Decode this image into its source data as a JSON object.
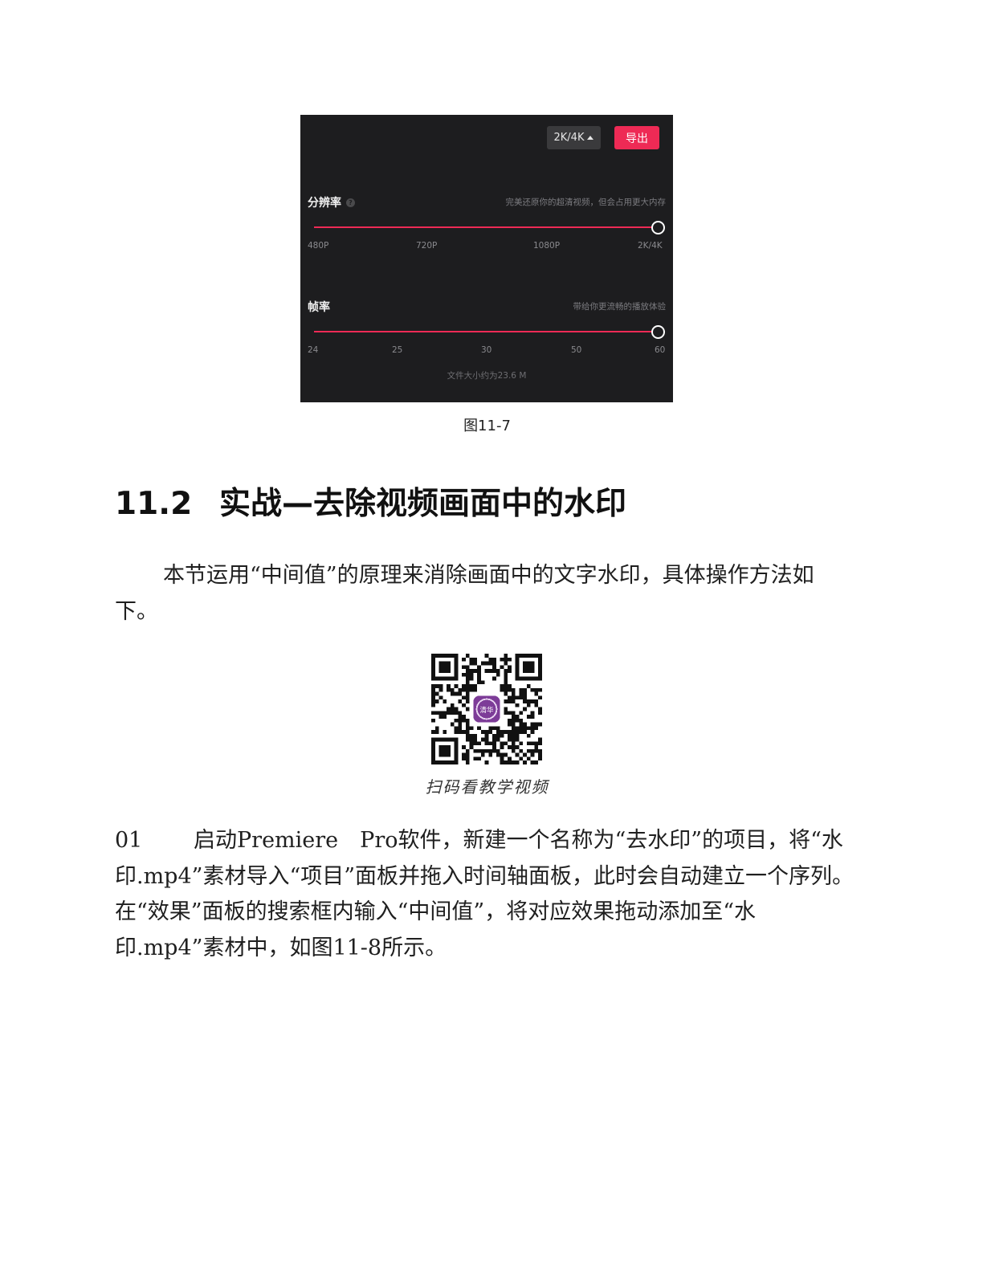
{
  "figure": {
    "resolution_button": "2K/4K",
    "export_button": "导出",
    "resolution": {
      "title": "分辨率",
      "help_mark": "?",
      "description": "完美还原你的超清视频，但会占用更大内存",
      "ticks": [
        "480P",
        "720P",
        "1080P",
        "2K/4K"
      ],
      "selected": "2K/4K"
    },
    "framerate": {
      "title": "帧率",
      "description": "带给你更流畅的播放体验",
      "ticks": [
        "24",
        "25",
        "30",
        "50",
        "60"
      ],
      "selected": "60"
    },
    "file_size": "文件大小约为23.6 M",
    "caption": "图11-7"
  },
  "section": {
    "number": "11.2",
    "title": "实战—去除视频画面中的水印"
  },
  "intro": "本节运用“中间值”的原理来消除画面中的文字水印，具体操作方法如下。",
  "qr": {
    "caption": "扫码看教学视频",
    "logo_text": "清华"
  },
  "step": {
    "number": "01",
    "text": "启动Premiere　Pro软件，新建一个名称为“去水印”的项目，将“水印.mp4”素材导入“项目”面板并拖入时间轴面板，此时会自动建立一个序列。在“效果”面板的搜索框内输入“中间值”，将对应效果拖动添加至“水印.mp4”素材中，如图11-8所示。"
  }
}
